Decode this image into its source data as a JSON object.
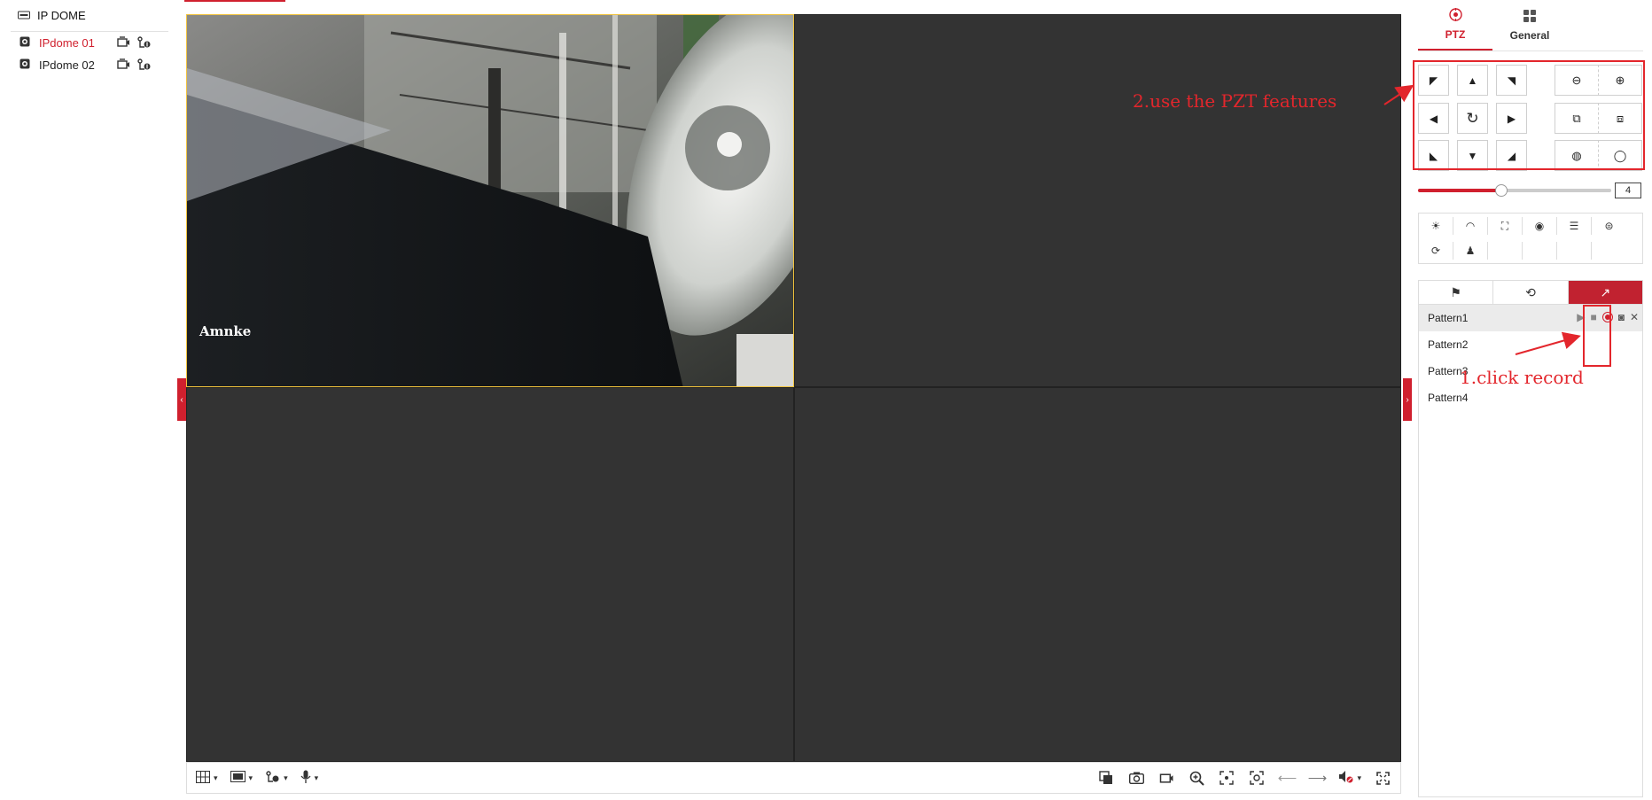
{
  "tree": {
    "root_label": "IP DOME",
    "devices": [
      {
        "label": "IPdome 01",
        "active": true
      },
      {
        "label": "IPdome 02",
        "active": false
      }
    ]
  },
  "video": {
    "osd_text": "Amnke"
  },
  "panel": {
    "tabs": [
      {
        "label": "PTZ",
        "icon": "ptz-target-icon",
        "active": true
      },
      {
        "label": "General",
        "icon": "grid-four-icon",
        "active": false
      }
    ],
    "speed": {
      "value": "4",
      "fraction": 0.43
    },
    "pattern_tabs": [
      "flag-icon",
      "cycle-icon",
      "pattern-trend-icon"
    ],
    "patterns": [
      "Pattern1",
      "Pattern2",
      "Pattern3",
      "Pattern4"
    ]
  },
  "annotations": {
    "ptz_note": "2.use the PZT features",
    "record_note": "1.click record"
  },
  "colors": {
    "accent": "#d0202e",
    "annotation": "#e3262c",
    "video_bg": "#333333",
    "selected_border": "#f0c23c"
  }
}
